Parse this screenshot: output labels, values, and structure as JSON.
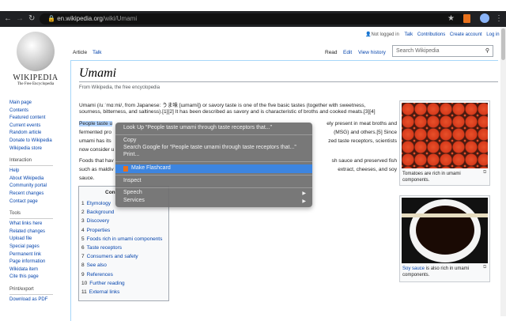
{
  "browser": {
    "url_host": "en.wikipedia.org",
    "url_path": "/wiki/Umami"
  },
  "logo": {
    "wordmark": "Wikipedia",
    "tagline": "The Free Encyclopedia"
  },
  "personal": {
    "status": "Not logged in",
    "links": [
      "Talk",
      "Contributions",
      "Create account",
      "Log in"
    ]
  },
  "tabs": {
    "left": [
      "Article",
      "Talk"
    ],
    "right": [
      "Read",
      "Edit",
      "View history"
    ]
  },
  "search": {
    "placeholder": "Search Wikipedia"
  },
  "sidebar": {
    "nav": [
      "Main page",
      "Contents",
      "Featured content",
      "Current events",
      "Random article",
      "Donate to Wikipedia",
      "Wikipedia store"
    ],
    "interaction_head": "Interaction",
    "interaction": [
      "Help",
      "About Wikipedia",
      "Community portal",
      "Recent changes",
      "Contact page"
    ],
    "tools_head": "Tools",
    "tools": [
      "What links here",
      "Related changes",
      "Upload file",
      "Special pages",
      "Permanent link",
      "Page information",
      "Wikidata item",
      "Cite this page"
    ],
    "print_head": "Print/export",
    "print": [
      "Download as PDF"
    ]
  },
  "article": {
    "title": "Umami",
    "subtitle": "From Wikipedia, the free encyclopedia",
    "lines": [
      "Umami (/uːˈmɑːmi/, from Japanese: うま味 [ɯmami]) or savory taste is one of the five basic tastes (together with sweetness,",
      "sourness, bitterness, and saltiness).[1][2] It has been described as savory and is characteristic of broths and cooked meats.[3][4]"
    ],
    "p2_left": [
      "People taste u",
      "fermented pro",
      "umami has its",
      "now consider u"
    ],
    "p2_right": [
      "ely present in meat broths and",
      "(MSG) and others.[5] Since",
      "zed taste receptors, scientists",
      ""
    ],
    "p3_left": [
      "Foods that hav",
      "such as maldiv",
      "sauce."
    ],
    "p3_right": [
      "sh sauce and preserved fish",
      "extract, cheeses, and soy",
      ""
    ]
  },
  "toc": {
    "title": "Con",
    "items": [
      {
        "n": "1",
        "t": "Etymology"
      },
      {
        "n": "2",
        "t": "Background"
      },
      {
        "n": "3",
        "t": "Discovery"
      },
      {
        "n": "4",
        "t": "Properties"
      },
      {
        "n": "5",
        "t": "Foods rich in umami components"
      },
      {
        "n": "6",
        "t": "Taste receptors"
      },
      {
        "n": "7",
        "t": "Consumers and safety"
      },
      {
        "n": "8",
        "t": "See also"
      },
      {
        "n": "9",
        "t": "References"
      },
      {
        "n": "10",
        "t": "Further reading"
      },
      {
        "n": "11",
        "t": "External links"
      }
    ]
  },
  "images": [
    {
      "caption": "Tomatoes are rich in umami components."
    },
    {
      "caption_link": "Soy sauce",
      "caption": " is also rich in umami components."
    }
  ],
  "context_menu": {
    "items": [
      "Look Up “People taste umami through taste receptors that...”",
      "Copy",
      "Search Google for “People taste umami through taste receptors that...”",
      "Print...",
      "Make Flashcard",
      "Inspect",
      "Speech",
      "Services"
    ]
  }
}
